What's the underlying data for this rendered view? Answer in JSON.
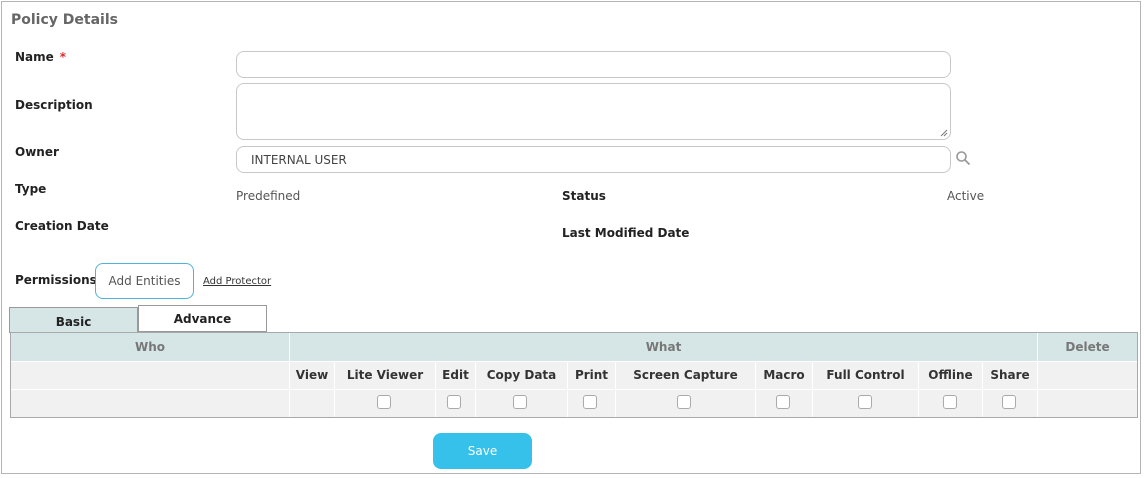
{
  "page_title": "Policy Details",
  "form": {
    "name_label": "Name",
    "required_mark": "*",
    "name_value": "",
    "description_label": "Description",
    "description_value": "",
    "owner_label": "Owner",
    "owner_value": "INTERNAL USER",
    "type_label": "Type",
    "type_value": "Predefined",
    "status_label": "Status",
    "status_value": "Active",
    "creation_date_label": "Creation Date",
    "creation_date_value": "",
    "last_modified_label": "Last Modified Date",
    "last_modified_value": ""
  },
  "permissions": {
    "label": "Permissions :",
    "add_entities": "Add Entities",
    "add_protector": "Add Protector"
  },
  "tabs": [
    {
      "label": "Basic",
      "active": true
    },
    {
      "label": "Advance",
      "active": false
    }
  ],
  "table": {
    "group_headers": {
      "who": "Who",
      "what": "What",
      "delete": "Delete"
    },
    "columns": [
      {
        "label": "View",
        "checkbox": false
      },
      {
        "label": "Lite Viewer",
        "checkbox": true
      },
      {
        "label": "Edit",
        "checkbox": true
      },
      {
        "label": "Copy Data",
        "checkbox": true
      },
      {
        "label": "Print",
        "checkbox": true
      },
      {
        "label": "Screen Capture",
        "checkbox": true
      },
      {
        "label": "Macro",
        "checkbox": true
      },
      {
        "label": "Full Control",
        "checkbox": true
      },
      {
        "label": "Offline",
        "checkbox": true
      },
      {
        "label": "Share",
        "checkbox": true
      }
    ]
  },
  "save_label": "Save",
  "colors": {
    "accent": "#35c1ea",
    "header_bg": "#d6e6e6",
    "required": "#d9302f"
  },
  "icons": {
    "owner_search": "magnifier-icon"
  }
}
